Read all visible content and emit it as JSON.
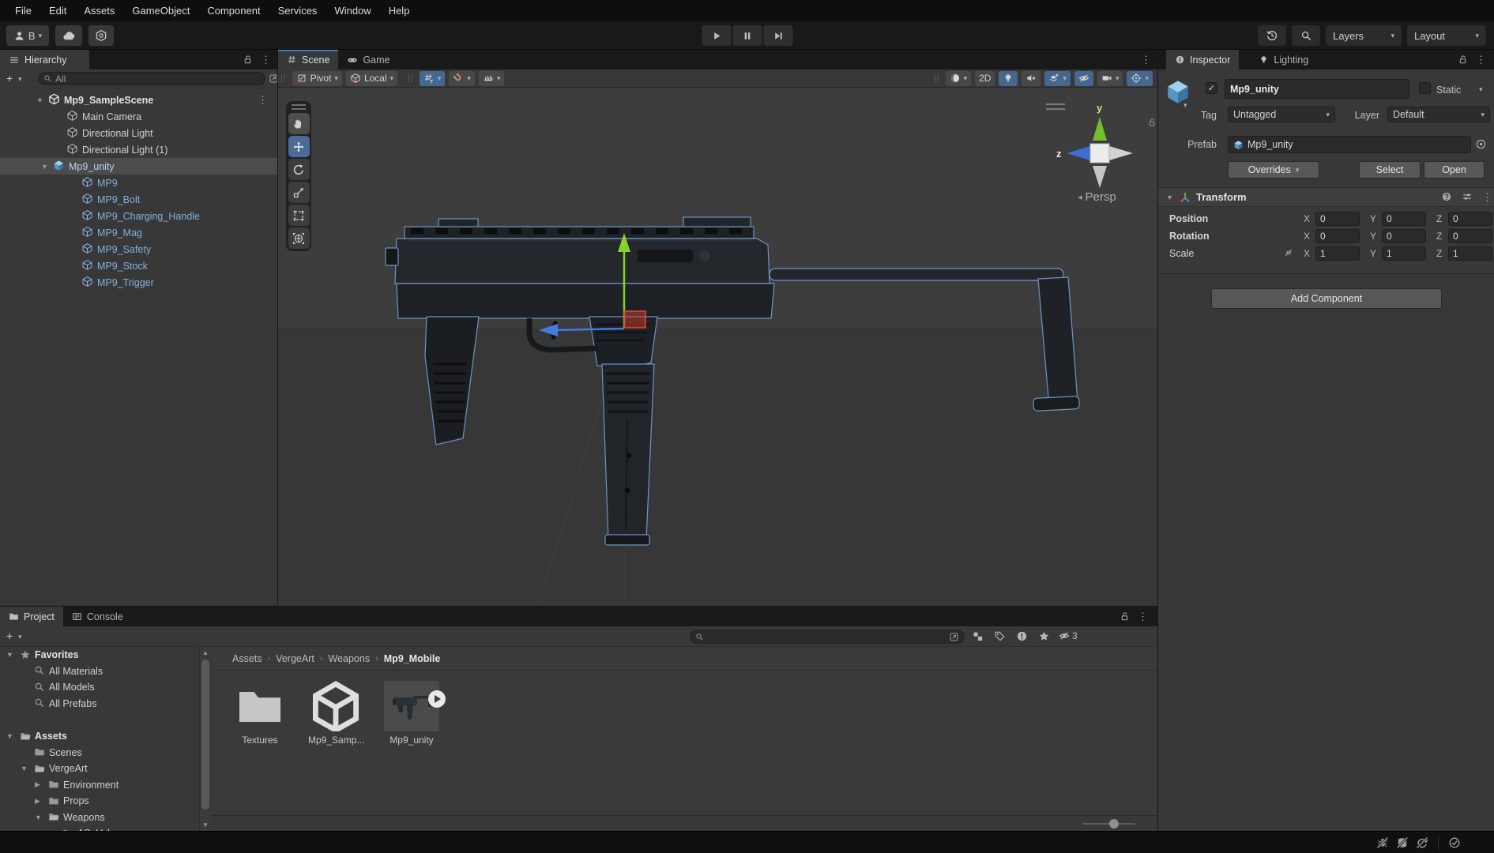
{
  "menu_bar": {
    "items": [
      "File",
      "Edit",
      "Assets",
      "GameObject",
      "Component",
      "Services",
      "Window",
      "Help"
    ]
  },
  "toolbar": {
    "account_label": "B",
    "layers_label": "Layers",
    "layout_label": "Layout"
  },
  "hierarchy": {
    "tab_label": "Hierarchy",
    "search_value": "All",
    "rows": [
      {
        "label": "Mp9_SampleScene",
        "kind": "root",
        "icon": "unity-scene",
        "expanded": true,
        "bold": true,
        "kebab": true
      },
      {
        "label": "Main Camera",
        "kind": "item",
        "icon": "cube"
      },
      {
        "label": "Directional Light",
        "kind": "item",
        "icon": "cube"
      },
      {
        "label": "Directional Light (1)",
        "kind": "item",
        "icon": "cube"
      },
      {
        "label": "Mp9_unity",
        "kind": "prefab-root",
        "icon": "prefab",
        "expanded": true,
        "selected": true
      },
      {
        "label": "MP9",
        "kind": "prefab-child",
        "icon": "cube-blue"
      },
      {
        "label": "MP9_Bolt",
        "kind": "prefab-child",
        "icon": "cube-blue"
      },
      {
        "label": "MP9_Charging_Handle",
        "kind": "prefab-child",
        "icon": "cube-blue"
      },
      {
        "label": "MP9_Mag",
        "kind": "prefab-child",
        "icon": "cube-blue"
      },
      {
        "label": "MP9_Safety",
        "kind": "prefab-child",
        "icon": "cube-blue"
      },
      {
        "label": "MP9_Stock",
        "kind": "prefab-child",
        "icon": "cube-blue"
      },
      {
        "label": "MP9_Trigger",
        "kind": "prefab-child",
        "icon": "cube-blue"
      }
    ]
  },
  "scene_view": {
    "tabs": [
      {
        "label": "Scene"
      },
      {
        "label": "Game"
      }
    ],
    "persp_label": "Persp",
    "axis_y_label": "y",
    "axis_z_label": "z",
    "left_buttons": [
      {
        "icon": "pivot",
        "label": "Pivot",
        "caret": true
      },
      {
        "icon": "local-cube",
        "label": "Local",
        "caret": true
      }
    ],
    "snap_buttons": [
      {
        "icon": "grid-y",
        "active": true,
        "caret": true
      },
      {
        "icon": "snap-magnet",
        "caret": true
      },
      {
        "icon": "snap-increment",
        "caret": true
      }
    ],
    "view_buttons": [
      {
        "icon": "shading-sphere",
        "caret": true
      },
      {
        "icon": "",
        "label": "2D"
      },
      {
        "icon": "light-bulb",
        "active": true
      },
      {
        "icon": "audio-mute"
      },
      {
        "icon": "effects",
        "active": true,
        "caret": true
      },
      {
        "icon": "visibility-eye",
        "active": true
      },
      {
        "icon": "scene-camera",
        "caret": true
      },
      {
        "icon": "gizmos-sphere",
        "active": true,
        "caret": true
      }
    ],
    "tools": [
      {
        "icon": "hand-tool",
        "state": "hover"
      },
      {
        "icon": "move-tool",
        "state": "active"
      },
      {
        "icon": "rotate-tool"
      },
      {
        "icon": "scale-tool"
      },
      {
        "icon": "rect-tool"
      },
      {
        "icon": "transform-tool"
      }
    ]
  },
  "inspector": {
    "tabs": [
      {
        "label": "Inspector"
      },
      {
        "label": "Lighting"
      }
    ],
    "object_name": "Mp9_unity",
    "object_enabled": true,
    "static_label": "Static",
    "tag_label": "Tag",
    "tag_value": "Untagged",
    "layer_label": "Layer",
    "layer_value": "Default",
    "prefab_label": "Prefab",
    "prefab_value": "Mp9_unity",
    "overrides_label": "Overrides",
    "select_label": "Select",
    "open_label": "Open",
    "transform": {
      "title": "Transform",
      "axis_labels": [
        "X",
        "Y",
        "Z"
      ],
      "rows": [
        {
          "label": "Position",
          "values": [
            "0",
            "0",
            "0"
          ]
        },
        {
          "label": "Rotation",
          "values": [
            "0",
            "0",
            "0"
          ]
        },
        {
          "label": "Scale",
          "values": [
            "1",
            "1",
            "1"
          ],
          "link_icon": true
        }
      ]
    },
    "add_component_label": "Add Component"
  },
  "project": {
    "tabs": [
      {
        "label": "Project"
      },
      {
        "label": "Console"
      }
    ],
    "favorites": {
      "label": "Favorites",
      "items": [
        "All Materials",
        "All Models",
        "All Prefabs"
      ]
    },
    "folders": [
      {
        "label": "Assets",
        "depth": 0,
        "state": "open",
        "bold": true
      },
      {
        "label": "Scenes",
        "depth": 1
      },
      {
        "label": "VergeArt",
        "depth": 1,
        "state": "open"
      },
      {
        "label": "Environment",
        "depth": 2,
        "state": "closed"
      },
      {
        "label": "Props",
        "depth": 2,
        "state": "closed"
      },
      {
        "label": "Weapons",
        "depth": 2,
        "state": "open"
      },
      {
        "label": "AS_Val",
        "depth": 3,
        "state": "closed"
      }
    ],
    "breadcrumb": [
      "Assets",
      "VergeArt",
      "Weapons",
      "Mp9_Mobile"
    ],
    "items": [
      {
        "label": "Textures",
        "type": "folder"
      },
      {
        "label": "Mp9_Samp...",
        "type": "unity-asset"
      },
      {
        "label": "Mp9_unity",
        "type": "model-preview",
        "play_badge": true
      }
    ],
    "hidden_count": "3"
  },
  "status_bar": {
    "icons": [
      "bug-disabled",
      "cache-server-disabled",
      "auto-refresh-disabled",
      "activity-check"
    ]
  },
  "colors": {
    "accent_blue": "#3a79bb",
    "active_tool_blue": "#4a6c96",
    "selection_row": "#4c4c4c",
    "prefab_text": "#84aede",
    "axis_green": "#88d32a",
    "axis_blue": "#4579e0",
    "plane_red": "#d5503a"
  }
}
